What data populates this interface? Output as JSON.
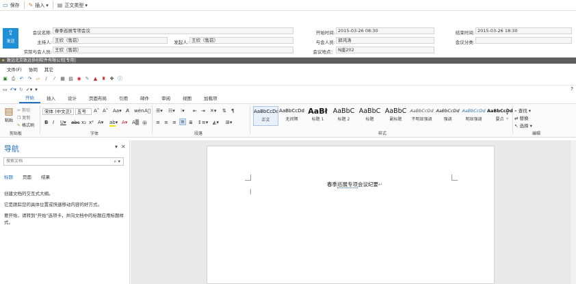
{
  "toolbar": {
    "save": "保存",
    "insert": "插入",
    "body_type": "正文类型"
  },
  "form": {
    "send": "发送",
    "meeting_name_label": "会议名称:",
    "meeting_name": "春季巡展专项会议",
    "host_label": "主持人:",
    "host": "王欣（售前）",
    "initiator_label": "发起人:",
    "initiator": "王欣（售前）",
    "actual_label": "实际与会人员:",
    "actual": "王欣（售前）",
    "start_label": "开始时间:",
    "start": "2015-03-26 08:30",
    "end_label": "结束时间:",
    "end": "2015-03-26 18:30",
    "attendees_label": "与会人员:",
    "attendees": "郭鸿涛",
    "category_label": "会议分类:",
    "category": "",
    "location_label": "会议地点：",
    "location": "N座202"
  },
  "darkbar": {
    "title": "致远北京致远协创软件有限公司[专用]"
  },
  "filemenu": [
    "文件(F)",
    "协同",
    "其它"
  ],
  "ribbon_tabs": [
    "开始",
    "插入",
    "设计",
    "页面布局",
    "引用",
    "邮件",
    "审阅",
    "视图",
    "加载项"
  ],
  "clipboard": {
    "paste": "粘贴",
    "cut": "剪切",
    "copy": "复制",
    "format_painter": "格式刷",
    "group": "剪贴板"
  },
  "font": {
    "name": "宋体 (中文正)",
    "size": "五号",
    "group": "字体"
  },
  "paragraph": {
    "group": "段落"
  },
  "styles": {
    "group": "样式",
    "items": [
      {
        "preview": "AaBbCcDd",
        "label": "正文"
      },
      {
        "preview": "AaBbCcDd",
        "label": "无间隔"
      },
      {
        "preview": "AaBł",
        "label": "标题 1"
      },
      {
        "preview": "AaBbC",
        "label": "标题 2"
      },
      {
        "preview": "AaBbC",
        "label": "标题"
      },
      {
        "preview": "AaBbC",
        "label": "副标题"
      },
      {
        "preview": "AaBbCcDd",
        "label": "不明显强调"
      },
      {
        "preview": "AaBbCcDd",
        "label": "强调"
      },
      {
        "preview": "AaBbCcDd",
        "label": "明显强调"
      },
      {
        "preview": "AaBbCcDd",
        "label": "要点"
      }
    ]
  },
  "editing": {
    "find": "查找",
    "replace": "替换",
    "select": "选择",
    "group": "编辑"
  },
  "nav": {
    "title": "导航",
    "search_placeholder": "搜索文档",
    "tabs": [
      "标题",
      "页面",
      "结果"
    ],
    "line1": "创建文档的交互式大纲。",
    "line2": "它是跟踪您的具体位置或快速移动内容的好方式。",
    "line3": "要开始，请转到\"开始\"选项卡，并向文档中的标题应用标题样式。"
  },
  "doc": {
    "title_a": "春季",
    "title_b": "巡展专项",
    "title_c": "会议纪要"
  },
  "help": "?"
}
